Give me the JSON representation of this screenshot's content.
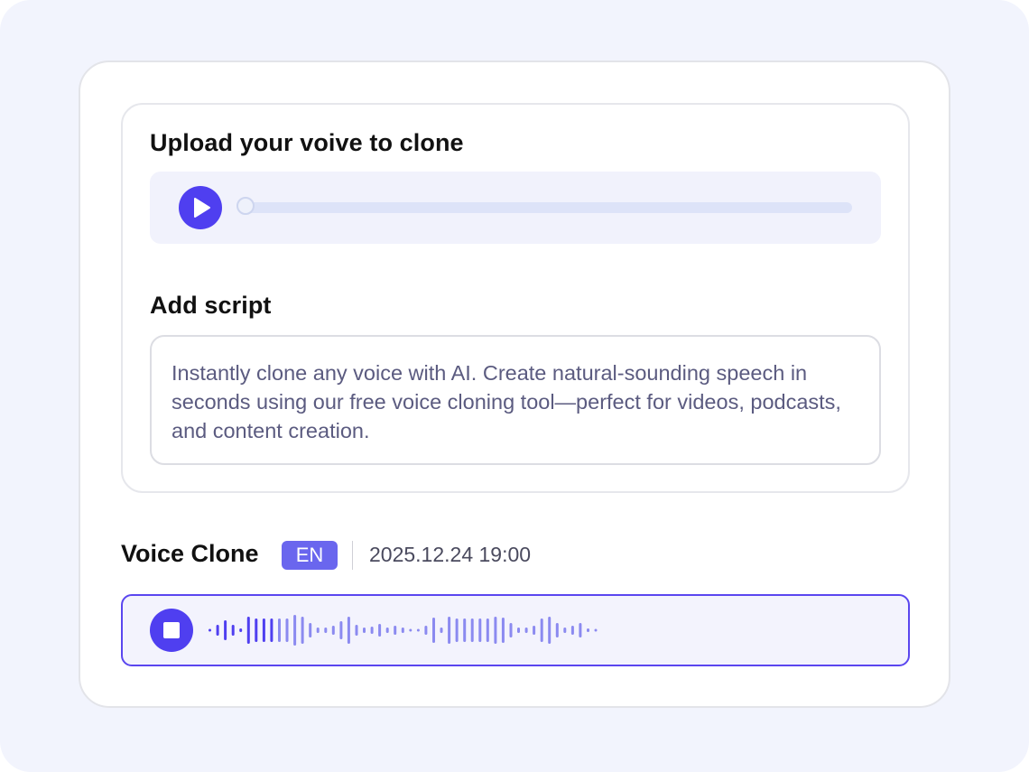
{
  "upload": {
    "title": "Upload your voive to clone",
    "progress": 0
  },
  "script": {
    "title": "Add script",
    "text": "Instantly clone any voice with AI. Create natural-sounding speech in seconds using our free voice cloning tool—perfect for videos, podcasts, and content creation."
  },
  "result": {
    "title": "Voice Clone",
    "language": "EN",
    "timestamp": "2025.12.24 19:00",
    "playback_progress": 0.18
  },
  "icons": {
    "play": "play-icon",
    "stop": "stop-icon"
  },
  "colors": {
    "accent": "#4f3ff0",
    "badge": "#6a66ee",
    "wave_played": "#4f3ff0",
    "wave_unplayed": "#8b8af0",
    "background": "#f2f4fd"
  }
}
